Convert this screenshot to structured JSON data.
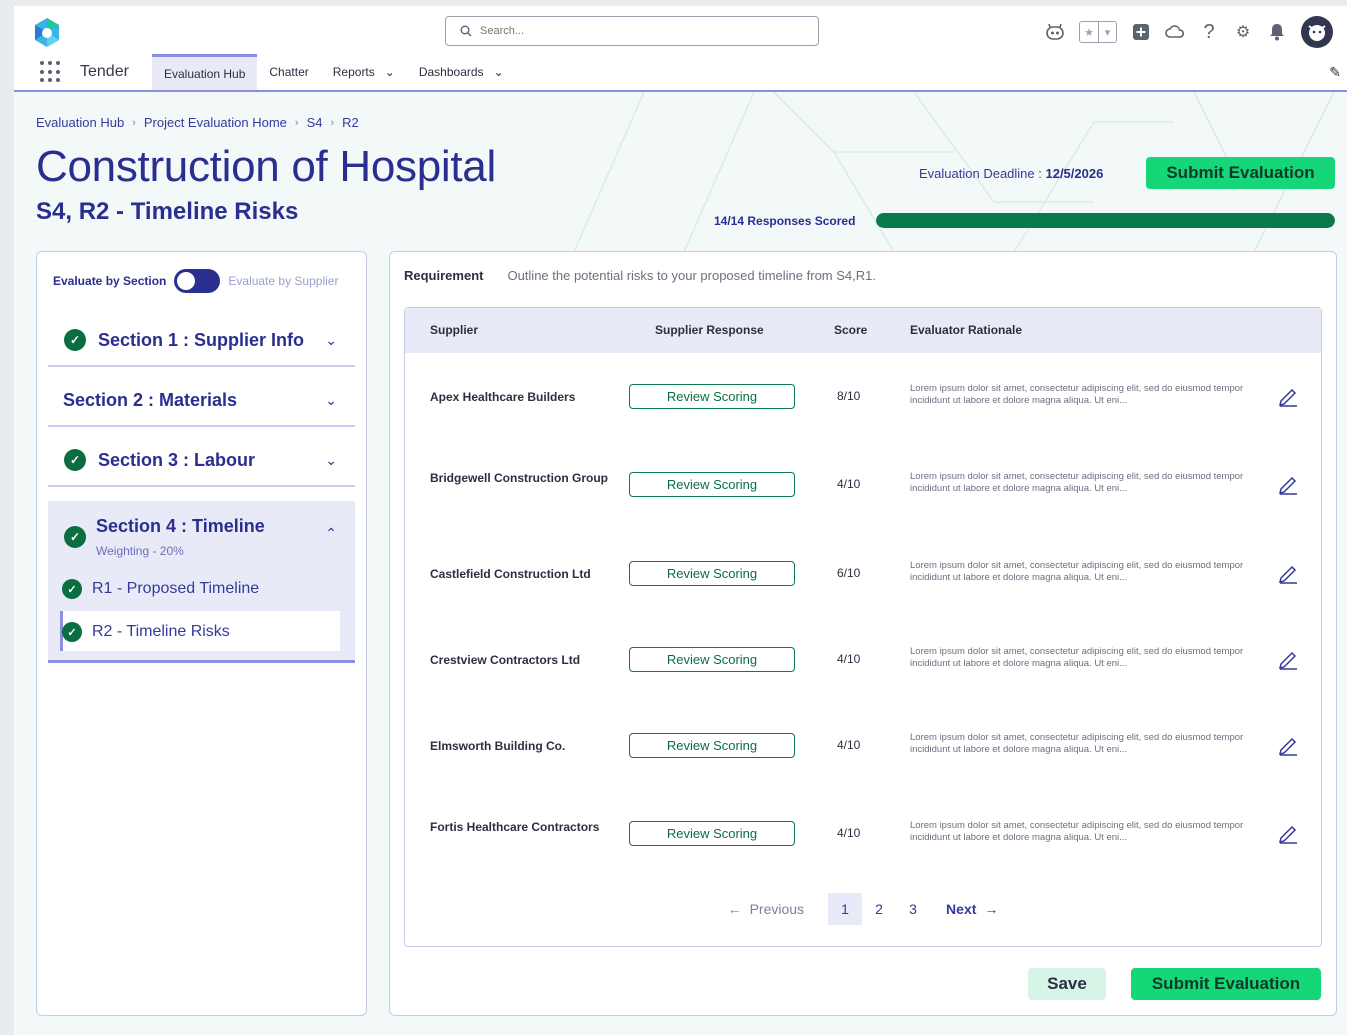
{
  "app": {
    "name": "Tender",
    "search_placeholder": "Search...",
    "nav_tabs": [
      {
        "label": "Evaluation Hub"
      },
      {
        "label": "Chatter"
      },
      {
        "label": "Reports"
      },
      {
        "label": "Dashboards"
      }
    ]
  },
  "breadcrumb": [
    "Evaluation Hub",
    "Project Evaluation Home",
    "S4",
    "R2"
  ],
  "header": {
    "title": "Construction of Hospital",
    "subtitle": "S4, R2 - Timeline Risks",
    "deadline_label": "Evaluation Deadline :",
    "deadline_value": "12/5/2026",
    "submit_label": "Submit Evaluation",
    "progress_label": "14/14 Responses Scored",
    "progress_fraction": 1.0
  },
  "sidebar": {
    "toggle_on_label": "Evaluate by Section",
    "toggle_off_label": "Evaluate by Supplier",
    "sections": [
      {
        "label": "Section 1 : Supplier Info"
      },
      {
        "label": "Section 2 : Materials"
      },
      {
        "label": "Section 3 : Labour"
      },
      {
        "label": "Section 4 : Timeline",
        "weighting": "Weighting - 20%"
      }
    ],
    "sub_items": [
      {
        "label": "R1 - Proposed Timeline"
      },
      {
        "label": "R2 - Timeline Risks"
      }
    ]
  },
  "main": {
    "requirement_label": "Requirement",
    "requirement_text": "Outline the potential risks to your proposed timeline from S4,R1.",
    "columns": [
      "Supplier",
      "Supplier Response",
      "Score",
      "Evaluator Rationale"
    ],
    "rows": [
      {
        "supplier": "Apex Healthcare Builders",
        "response": "Review Scoring",
        "score": "8/10",
        "rationale": "Lorem ipsum dolor sit amet, consectetur adipiscing elit, sed do eiusmod tempor incididunt ut labore et dolore magna aliqua. Ut eni..."
      },
      {
        "supplier": "Bridgewell Construction Group",
        "response": "Review Scoring",
        "score": "4/10",
        "rationale": "Lorem ipsum dolor sit amet, consectetur adipiscing elit, sed do eiusmod tempor incididunt ut labore et dolore magna aliqua. Ut eni..."
      },
      {
        "supplier": "Castlefield Construction Ltd",
        "response": "Review Scoring",
        "score": "6/10",
        "rationale": "Lorem ipsum dolor sit amet, consectetur adipiscing elit, sed do eiusmod tempor incididunt ut labore et dolore magna aliqua. Ut eni..."
      },
      {
        "supplier": "Crestview Contractors Ltd",
        "response": "Review Scoring",
        "score": "4/10",
        "rationale": "Lorem ipsum dolor sit amet, consectetur adipiscing elit, sed do eiusmod tempor incididunt ut labore et dolore magna aliqua. Ut eni..."
      },
      {
        "supplier": "Elmsworth Building Co.",
        "response": "Review Scoring",
        "score": "4/10",
        "rationale": "Lorem ipsum dolor sit amet, consectetur adipiscing elit, sed do eiusmod tempor incididunt ut labore et dolore magna aliqua. Ut eni..."
      },
      {
        "supplier": "Fortis Healthcare Contractors",
        "response": "Review Scoring",
        "score": "4/10",
        "rationale": "Lorem ipsum dolor sit amet, consectetur adipiscing elit, sed do eiusmod tempor incididunt ut labore et dolore magna aliqua. Ut eni..."
      }
    ],
    "pagination": {
      "prev": "Previous",
      "pages": [
        "1",
        "2",
        "3"
      ],
      "current": "1",
      "next": "Next"
    },
    "save_label": "Save",
    "submit_label": "Submit Evaluation"
  },
  "colors": {
    "brand": "#2a2e8f",
    "accent": "#15d777",
    "progress": "#0b7a4a",
    "nav_active": "#8b8fe0"
  },
  "icons": [
    "salesforce-cloud-icon",
    "search-icon",
    "agent-icon",
    "star-icon",
    "chevron-down-icon",
    "plus-icon",
    "cloud-icon",
    "help-icon",
    "gear-icon",
    "bell-icon",
    "avatar-icon",
    "waffle-icon",
    "pencil-icon",
    "check-icon",
    "arrow-left-icon",
    "arrow-right-icon"
  ]
}
